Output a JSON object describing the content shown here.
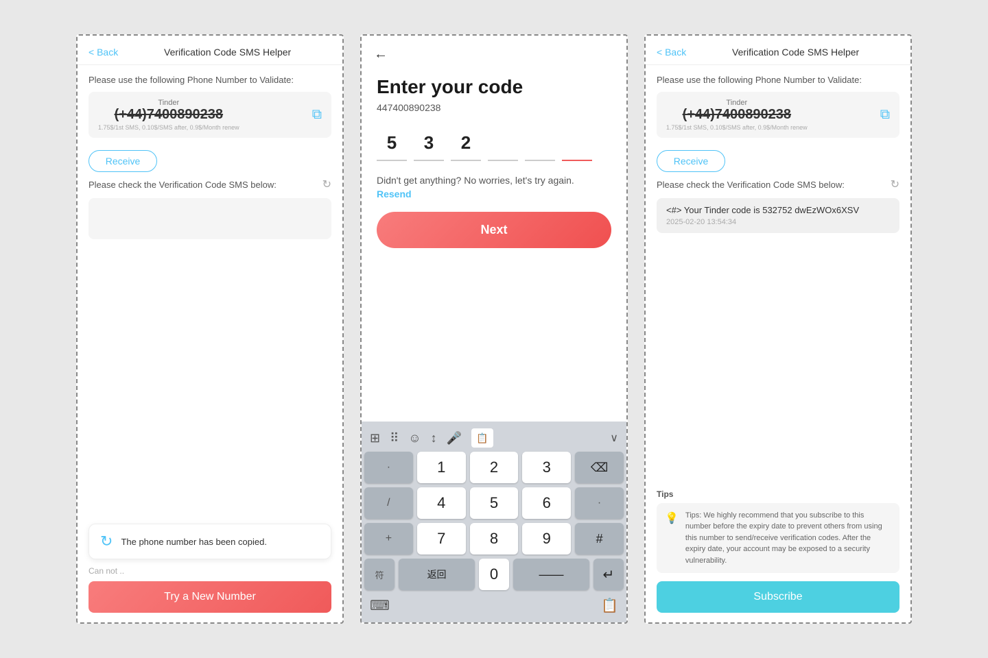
{
  "panel1": {
    "header": {
      "back_label": "< Back",
      "title": "Verification Code SMS Helper"
    },
    "validate_text": "Please use the following Phone Number to Validate:",
    "number_box": {
      "service_label": "Tinder",
      "number": "(+44)7400890238",
      "sub_text": "1.75$/1st SMS, 0.10$/SMS after, 0.9$/Month renew"
    },
    "receive_btn_label": "Receive",
    "check_text": "Please check the Verification Code SMS below:",
    "toast": {
      "text": "The phone number has been copied."
    },
    "cannot_text": "Can not ..",
    "new_number_btn_label": "Try a New Number"
  },
  "panel2": {
    "title": "Enter your code",
    "phone_number": "447400890238",
    "code_digits": [
      "5",
      "3",
      "2",
      "",
      "",
      ""
    ],
    "no_code_text": "Didn't get anything? No worries, let's try again.",
    "resend_label": "Resend",
    "next_btn_label": "Next",
    "keyboard": {
      "row1": [
        ".",
        "1",
        "2",
        "3",
        "⌫"
      ],
      "row2": [
        "/",
        "4",
        "5",
        "6",
        "·"
      ],
      "row3": [
        "+",
        "7",
        "8",
        "9",
        "#"
      ],
      "row4": [
        "符",
        "返回",
        "0",
        "——",
        "↵"
      ],
      "toolbar_icons": [
        "⊞⊞",
        "⠿",
        "☺",
        "↕",
        "🎤",
        "🔲",
        "∨"
      ]
    }
  },
  "panel3": {
    "header": {
      "back_label": "< Back",
      "title": "Verification Code SMS Helper"
    },
    "validate_text": "Please use the following Phone Number to Validate:",
    "number_box": {
      "service_label": "Tinder",
      "number": "(+44)7400890238",
      "sub_text": "1.75$/1st SMS, 0.10$/SMS after, 0.9$/Month renew"
    },
    "receive_btn_label": "Receive",
    "check_text": "Please check the Verification Code SMS below:",
    "sms_message": "<#> Your Tinder code is 532752 dwEzWOx6XSV",
    "sms_time": "2025-02-20 13:54:34",
    "tips_label": "Tips",
    "tips_text": "Tips: We highly recommend that you subscribe to this number before the expiry date to prevent others from using this number to send/receive verification codes. After the expiry date, your account may be exposed to a security vulnerability.",
    "subscribe_btn_label": "Subscribe"
  },
  "colors": {
    "accent_blue": "#4fc3f7",
    "accent_teal": "#4dd0e1",
    "accent_red": "#f05a5a",
    "gradient_start": "#f87c7c",
    "gradient_end": "#f05050"
  }
}
